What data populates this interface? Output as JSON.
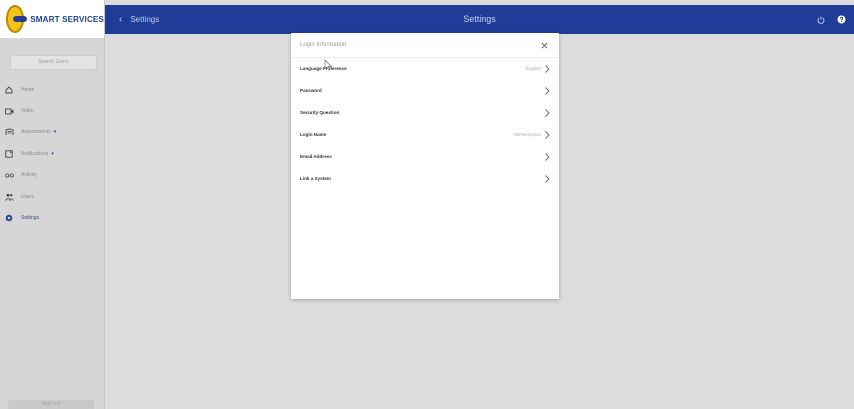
{
  "brand": {
    "name": "SMART SERVICES"
  },
  "sidebar": {
    "search_label": "Search Users",
    "items": [
      {
        "label": "Home",
        "icon": "home-icon"
      },
      {
        "label": "Video",
        "icon": "video-icon"
      },
      {
        "label": "Assessments",
        "icon": "assessments-icon",
        "has_caret": true
      },
      {
        "label": "Notifications",
        "icon": "notifications-icon",
        "has_caret": true
      },
      {
        "label": "Activity",
        "icon": "activity-icon"
      },
      {
        "label": "Users",
        "icon": "users-icon"
      },
      {
        "label": "Settings",
        "icon": "settings-icon",
        "active": true
      }
    ],
    "bottom_label": "Sign out",
    "caret": "▾"
  },
  "topbar": {
    "back_label": "Settings",
    "title": "Settings",
    "color": "#1f3c99"
  },
  "modal": {
    "title": "Login Information",
    "rows": [
      {
        "label": "Language Preference",
        "value": "English"
      },
      {
        "label": "Password",
        "value": ""
      },
      {
        "label": "Security Question",
        "value": ""
      },
      {
        "label": "Login Name",
        "value": "ARRecepcion"
      },
      {
        "label": "Email Address",
        "value": ""
      },
      {
        "label": "Link a System",
        "value": ""
      }
    ]
  },
  "colors": {
    "accent": "#1f3c99",
    "active_nav": "#2a4aa5"
  }
}
